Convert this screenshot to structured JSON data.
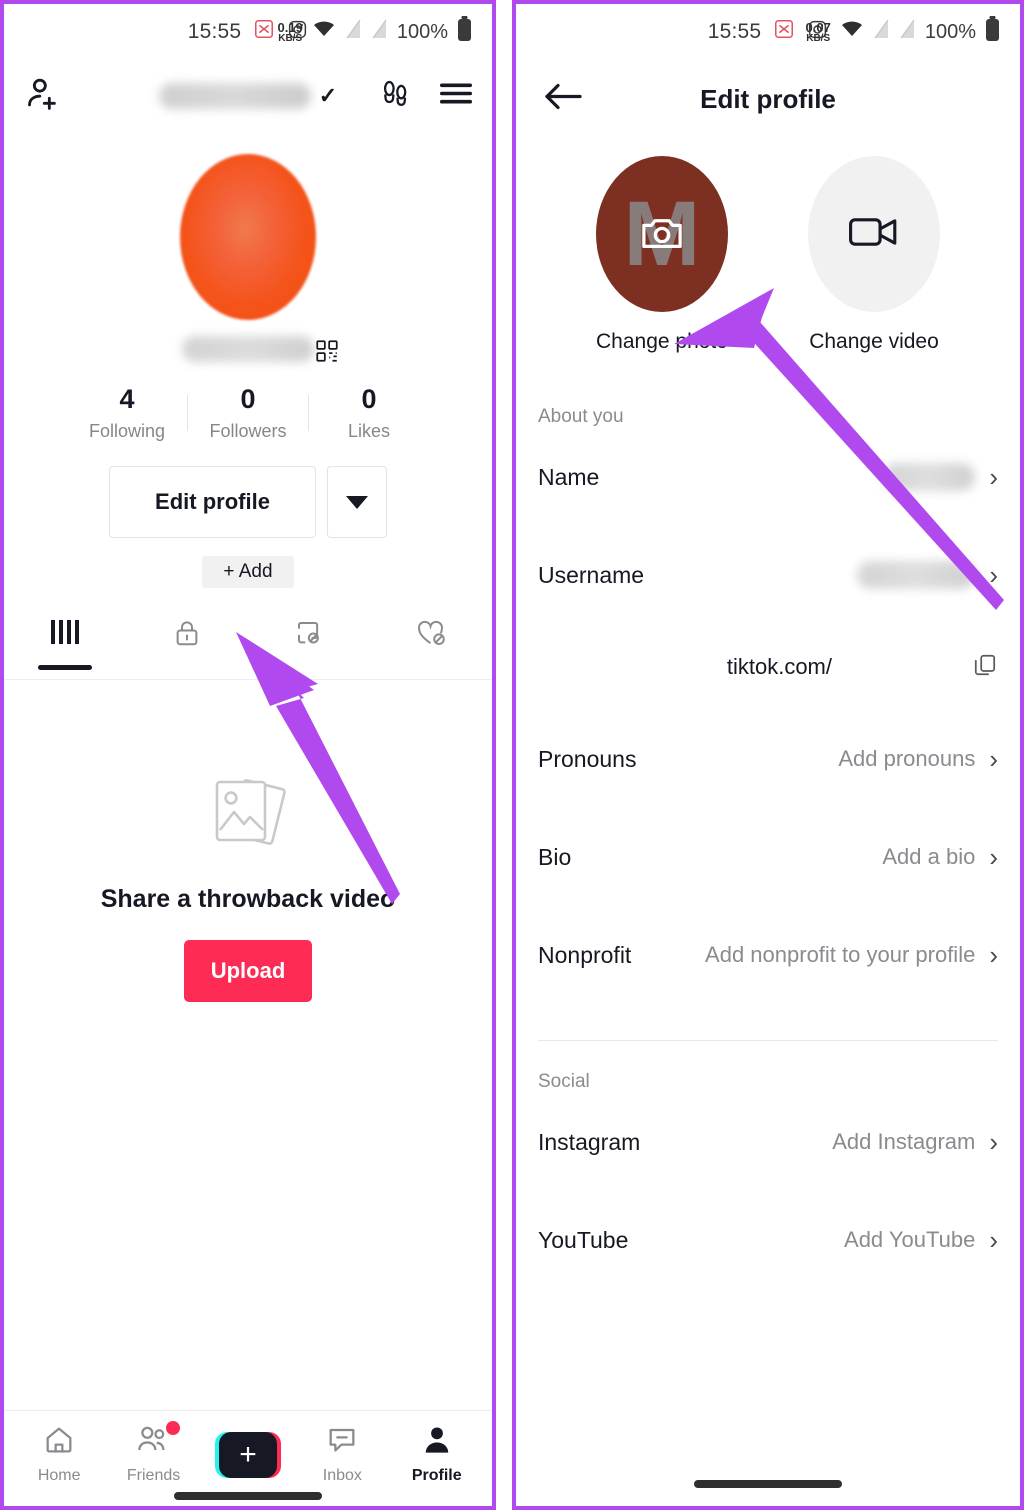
{
  "left_panel": {
    "status_bar": {
      "time": "15:55",
      "net_speed_value": "0.19",
      "net_speed_unit": "KB/S",
      "battery_percent": "100%",
      "icons": [
        "scissors-icon",
        "instagram-icon",
        "wifi-icon",
        "sim1-icon",
        "sim2-icon",
        "battery-icon"
      ]
    },
    "header": {
      "add_user_icon": "add-user-icon",
      "username_redacted": "",
      "verified_check": "✓",
      "footprint_icon": "footprint-icon",
      "menu_icon": "hamburger-menu-icon"
    },
    "profile": {
      "avatar_label": "profile-avatar",
      "handle_redacted": "",
      "qr_icon": "qr-code-icon"
    },
    "stats": [
      {
        "num": "4",
        "label": "Following"
      },
      {
        "num": "0",
        "label": "Followers"
      },
      {
        "num": "0",
        "label": "Likes"
      }
    ],
    "actions": {
      "edit_profile": "Edit profile",
      "dropdown_icon": "chevron-down-icon",
      "add_bio": "+ Add"
    },
    "tabs": [
      {
        "icon": "grid-posts-icon",
        "active": true
      },
      {
        "icon": "lock-private-icon",
        "active": false
      },
      {
        "icon": "repost-icon",
        "active": false
      },
      {
        "icon": "liked-hidden-icon",
        "active": false
      }
    ],
    "empty_state": {
      "image_icon": "photos-stack-icon",
      "title": "Share a throwback video",
      "button": "Upload"
    },
    "bottom_nav": [
      {
        "label": "Home",
        "icon": "home-icon",
        "active": false,
        "badge": false
      },
      {
        "label": "Friends",
        "icon": "friends-icon",
        "active": false,
        "badge": true
      },
      {
        "label": "",
        "icon": "create-plus-icon",
        "active": false,
        "badge": false
      },
      {
        "label": "Inbox",
        "icon": "inbox-icon",
        "active": false,
        "badge": false
      },
      {
        "label": "Profile",
        "icon": "profile-person-icon",
        "active": true,
        "badge": false
      }
    ]
  },
  "right_panel": {
    "status_bar": {
      "time": "15:55",
      "net_speed_value": "0.07",
      "net_speed_unit": "KB/S",
      "battery_percent": "100%"
    },
    "header": {
      "back_icon": "back-arrow-icon",
      "title": "Edit profile"
    },
    "media": [
      {
        "label": "Change photo",
        "icon": "camera-icon",
        "avatar_letter": "M",
        "bg": "#7d3021"
      },
      {
        "label": "Change video",
        "icon": "video-camera-icon",
        "avatar_letter": "",
        "bg": "#f1f1f2"
      }
    ],
    "about_section_title": "About you",
    "about_rows": [
      {
        "label": "Name",
        "value": "",
        "redacted": true,
        "chevron": "chevron-right-icon"
      },
      {
        "label": "Username",
        "value": "",
        "redacted": true,
        "chevron": "chevron-right-icon"
      },
      {
        "label": "Pronouns",
        "value": "Add pronouns",
        "redacted": false,
        "chevron": "chevron-right-icon"
      },
      {
        "label": "Bio",
        "value": "Add a bio",
        "redacted": false,
        "chevron": "chevron-right-icon"
      },
      {
        "label": "Nonprofit",
        "value": "Add nonprofit to your profile",
        "redacted": false,
        "chevron": "chevron-right-icon"
      }
    ],
    "profile_url": {
      "text": "tiktok.com/",
      "handle_redacted": "",
      "copy_icon": "copy-icon"
    },
    "social_section_title": "Social",
    "social_rows": [
      {
        "label": "Instagram",
        "value": "Add Instagram",
        "chevron": "chevron-right-icon"
      },
      {
        "label": "YouTube",
        "value": "Add YouTube",
        "chevron": "chevron-right-icon"
      }
    ]
  },
  "annotations": {
    "arrow_color": "#b14aee",
    "arrow_left_target": "Edit profile",
    "arrow_right_target": "Change photo"
  },
  "theme": {
    "accent_pink": "#fe2c55",
    "accent_cyan": "#25f4ee",
    "text_primary": "#161823",
    "text_secondary": "#8a8b8f",
    "panel_border": "#b14aee"
  }
}
